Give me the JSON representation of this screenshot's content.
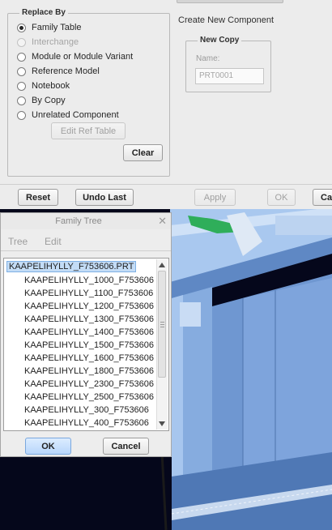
{
  "replace_dialog": {
    "replace_by": {
      "legend": "Replace By",
      "options": [
        {
          "label": "Family Table",
          "checked": true,
          "enabled": true
        },
        {
          "label": "Interchange",
          "checked": false,
          "enabled": false
        },
        {
          "label": "Module or Module Variant",
          "checked": false,
          "enabled": true
        },
        {
          "label": "Reference Model",
          "checked": false,
          "enabled": true
        },
        {
          "label": "Notebook",
          "checked": false,
          "enabled": true
        },
        {
          "label": "By Copy",
          "checked": false,
          "enabled": true
        },
        {
          "label": "Unrelated Component",
          "checked": false,
          "enabled": true
        }
      ],
      "edit_ref_table_label": "Edit Ref Table",
      "clear_label": "Clear"
    },
    "create_new_component_label": "Create New Component",
    "new_copy": {
      "legend": "New Copy",
      "name_label": "Name:",
      "name_value": "PRT0001"
    },
    "footer": {
      "reset_label": "Reset",
      "undo_last_label": "Undo Last",
      "apply_label": "Apply",
      "ok_label": "OK",
      "cancel_label": "Ca"
    }
  },
  "family_tree": {
    "title": "Family Tree",
    "menu": {
      "tree": "Tree",
      "edit": "Edit"
    },
    "root": "KAAPELIHYLLY_F753606.PRT",
    "items": [
      "KAAPELIHYLLY_1000_F753606",
      "KAAPELIHYLLY_1100_F753606",
      "KAAPELIHYLLY_1200_F753606",
      "KAAPELIHYLLY_1300_F753606",
      "KAAPELIHYLLY_1400_F753606",
      "KAAPELIHYLLY_1500_F753606",
      "KAAPELIHYLLY_1600_F753606",
      "KAAPELIHYLLY_1800_F753606",
      "KAAPELIHYLLY_2300_F753606",
      "KAAPELIHYLLY_2500_F753606",
      "KAAPELIHYLLY_300_F753606",
      "KAAPELIHYLLY_400_F753606"
    ],
    "ok_label": "OK",
    "cancel_label": "Cancel"
  },
  "colors": {
    "model_blue": "#8fb6e8",
    "model_dark": "#0a0d26",
    "highlight_green": "#2fae5a",
    "selection": "#c3dcf6"
  }
}
